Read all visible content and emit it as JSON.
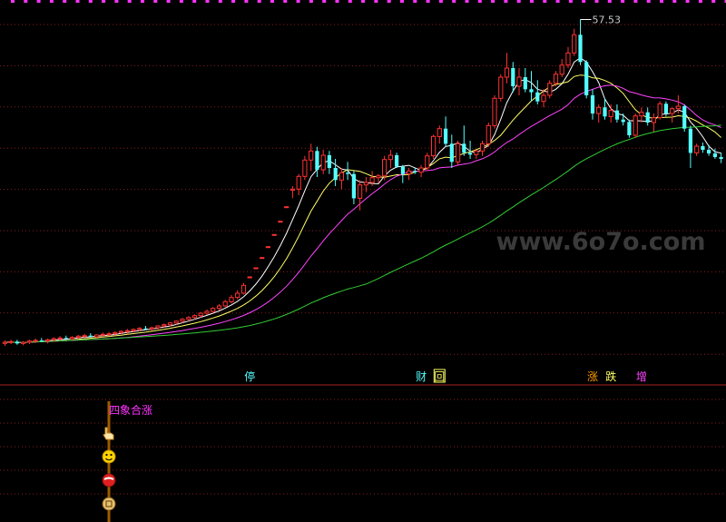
{
  "chart_data": [
    {
      "type": "candlestick",
      "panel": "price",
      "title": "",
      "high_label": "57.53",
      "grid": true,
      "grid_style": "dotted",
      "bg_color": "#000000",
      "up_color": "#ff3232",
      "down_color": "#54ffff",
      "ma_colors": [
        "#ffffff",
        "#ffff66",
        "#ff44ff",
        "#33cc33"
      ],
      "candles_ohlc": [
        [
          4.0,
          4.5,
          3.6,
          4.2
        ],
        [
          4.2,
          4.6,
          3.9,
          4.3
        ],
        [
          4.3,
          4.6,
          3.8,
          4.0
        ],
        [
          4.0,
          4.4,
          3.7,
          4.2
        ],
        [
          4.2,
          4.6,
          3.9,
          4.4
        ],
        [
          4.4,
          4.8,
          4.1,
          4.5
        ],
        [
          4.5,
          4.9,
          4.2,
          4.4
        ],
        [
          4.4,
          4.8,
          4.0,
          4.6
        ],
        [
          4.6,
          5.0,
          4.3,
          4.8
        ],
        [
          4.8,
          5.2,
          4.5,
          4.9
        ],
        [
          4.9,
          5.3,
          4.6,
          4.8
        ],
        [
          4.8,
          5.2,
          4.5,
          5.0
        ],
        [
          5.0,
          5.4,
          4.7,
          5.2
        ],
        [
          5.2,
          5.6,
          4.9,
          5.3
        ],
        [
          5.3,
          5.7,
          5.0,
          5.1
        ],
        [
          5.1,
          5.5,
          4.8,
          5.4
        ],
        [
          5.4,
          5.8,
          5.1,
          5.5
        ],
        [
          5.5,
          5.9,
          5.2,
          5.6
        ],
        [
          5.6,
          6.0,
          5.3,
          5.8
        ],
        [
          5.8,
          6.2,
          5.5,
          6.0
        ],
        [
          6.0,
          6.4,
          5.6,
          6.1
        ],
        [
          6.1,
          6.5,
          5.8,
          6.3
        ],
        [
          6.3,
          6.7,
          6.0,
          6.5
        ],
        [
          6.5,
          6.9,
          6.2,
          6.4
        ],
        [
          6.4,
          6.8,
          6.1,
          6.6
        ],
        [
          6.6,
          7.0,
          6.3,
          6.9
        ],
        [
          6.9,
          7.3,
          6.6,
          7.1
        ],
        [
          7.1,
          7.5,
          6.8,
          7.4
        ],
        [
          7.4,
          7.8,
          7.1,
          7.7
        ],
        [
          7.7,
          8.2,
          7.4,
          8.0
        ],
        [
          8.0,
          8.5,
          7.7,
          8.3
        ],
        [
          8.3,
          8.8,
          8.0,
          8.6
        ],
        [
          8.6,
          9.2,
          8.3,
          9.0
        ],
        [
          9.0,
          9.6,
          8.7,
          9.3
        ],
        [
          9.3,
          10.0,
          9.0,
          9.8
        ],
        [
          9.8,
          10.5,
          9.5,
          10.2
        ],
        [
          10.2,
          11.2,
          10.0,
          10.9
        ],
        [
          10.9,
          12.0,
          10.6,
          11.6
        ],
        [
          11.6,
          12.8,
          11.3,
          12.3
        ],
        [
          12.3,
          14.0,
          12.1,
          13.6
        ],
        [
          15.0,
          15.0,
          15.0,
          15.0
        ],
        [
          16.5,
          16.5,
          16.5,
          16.5
        ],
        [
          18.2,
          18.2,
          18.2,
          18.2
        ],
        [
          20.0,
          20.0,
          20.0,
          20.0
        ],
        [
          22.0,
          22.0,
          22.0,
          22.0
        ],
        [
          24.2,
          24.2,
          24.2,
          24.2
        ],
        [
          26.6,
          26.6,
          26.6,
          26.6
        ],
        [
          29.3,
          30.0,
          28.0,
          29.5
        ],
        [
          29.5,
          32.0,
          28.5,
          31.6
        ],
        [
          31.6,
          35.0,
          31.0,
          34.3
        ],
        [
          34.3,
          37.0,
          32.5,
          35.8
        ],
        [
          35.8,
          36.5,
          31.5,
          32.7
        ],
        [
          32.7,
          36.0,
          32.0,
          35.1
        ],
        [
          35.1,
          35.8,
          32.0,
          33.0
        ],
        [
          33.0,
          34.5,
          30.0,
          31.0
        ],
        [
          31.0,
          33.0,
          29.5,
          32.2
        ],
        [
          32.2,
          34.0,
          31.0,
          32.0
        ],
        [
          32.0,
          32.5,
          27.0,
          28.0
        ],
        [
          28.0,
          31.0,
          26.0,
          30.2
        ],
        [
          30.2,
          31.5,
          29.0,
          30.6
        ],
        [
          30.6,
          32.5,
          30.0,
          31.4
        ],
        [
          31.4,
          32.0,
          30.5,
          31.7
        ],
        [
          31.7,
          35.0,
          31.0,
          34.4
        ],
        [
          34.4,
          36.0,
          33.0,
          35.1
        ],
        [
          35.1,
          35.5,
          33.0,
          33.2
        ],
        [
          33.2,
          33.5,
          30.5,
          32.0
        ],
        [
          32.0,
          33.0,
          31.0,
          32.5
        ],
        [
          32.5,
          33.0,
          32.0,
          32.3
        ],
        [
          32.3,
          33.5,
          31.5,
          33.0
        ],
        [
          33.0,
          35.5,
          32.5,
          35.0
        ],
        [
          35.0,
          38.5,
          34.5,
          38.2
        ],
        [
          38.2,
          40.0,
          37.0,
          39.5
        ],
        [
          39.5,
          41.5,
          36.5,
          37.0
        ],
        [
          37.0,
          38.5,
          33.0,
          34.0
        ],
        [
          34.0,
          37.5,
          33.5,
          37.0
        ],
        [
          37.0,
          40.0,
          35.0,
          35.5
        ],
        [
          35.5,
          37.5,
          34.5,
          35.2
        ],
        [
          35.2,
          36.0,
          34.5,
          35.8
        ],
        [
          35.8,
          37.5,
          35.0,
          37.0
        ],
        [
          37.0,
          40.5,
          36.5,
          40.0
        ],
        [
          40.0,
          45.0,
          39.5,
          44.5
        ],
        [
          44.5,
          48.5,
          44.0,
          48.0
        ],
        [
          48.0,
          52.0,
          47.0,
          49.5
        ],
        [
          49.5,
          50.5,
          45.5,
          46.5
        ],
        [
          46.5,
          49.5,
          45.0,
          48.0
        ],
        [
          48.0,
          49.5,
          45.5,
          46.0
        ],
        [
          46.0,
          49.0,
          44.0,
          45.5
        ],
        [
          45.5,
          47.5,
          43.5,
          44.0
        ],
        [
          44.0,
          46.0,
          43.0,
          45.0
        ],
        [
          45.0,
          47.5,
          44.5,
          47.0
        ],
        [
          47.0,
          49.0,
          46.5,
          48.5
        ],
        [
          48.5,
          51.0,
          48.0,
          50.0
        ],
        [
          50.0,
          53.0,
          49.5,
          52.0
        ],
        [
          52.0,
          56.0,
          51.5,
          55.0
        ],
        [
          55.0,
          57.53,
          50.0,
          50.5
        ],
        [
          50.5,
          50.8,
          44.5,
          45.0
        ],
        [
          45.0,
          46.0,
          41.0,
          42.0
        ],
        [
          42.0,
          43.5,
          40.5,
          43.0
        ],
        [
          43.0,
          44.5,
          41.0,
          41.5
        ],
        [
          41.5,
          43.5,
          40.5,
          42.5
        ],
        [
          42.5,
          43.5,
          40.5,
          41.0
        ],
        [
          41.0,
          42.0,
          40.0,
          40.6
        ],
        [
          40.6,
          41.0,
          38.0,
          38.4
        ],
        [
          38.4,
          42.0,
          38.0,
          41.6
        ],
        [
          41.6,
          43.0,
          40.5,
          42.2
        ],
        [
          42.2,
          43.0,
          40.0,
          40.5
        ],
        [
          40.5,
          42.0,
          39.0,
          41.3
        ],
        [
          41.3,
          44.0,
          41.0,
          43.6
        ],
        [
          43.6,
          44.0,
          41.5,
          42.0
        ],
        [
          42.0,
          43.0,
          40.5,
          42.8
        ],
        [
          42.8,
          45.0,
          42.0,
          43.2
        ],
        [
          43.2,
          43.5,
          39.0,
          39.5
        ],
        [
          39.5,
          40.0,
          33.0,
          35.5
        ],
        [
          35.5,
          37.0,
          35.0,
          36.6
        ],
        [
          36.6,
          37.2,
          35.5,
          36.0
        ],
        [
          36.0,
          36.8,
          35.0,
          35.4
        ],
        [
          35.4,
          36.2,
          34.5,
          34.8
        ],
        [
          34.8,
          35.5,
          33.8,
          34.5
        ]
      ],
      "signals": [
        {
          "text": "停",
          "idx": 40,
          "color": "#54ffff"
        },
        {
          "text": "财",
          "idx": 68,
          "color": "#54ffff"
        },
        {
          "text": "回",
          "idx": 71,
          "color": "#ffff66",
          "boxed": true
        },
        {
          "text": "涨",
          "idx": 96,
          "color": "#ff9900"
        },
        {
          "text": "跌",
          "idx": 99,
          "color": "#ffff66"
        },
        {
          "text": "增",
          "idx": 104,
          "color": "#ff44ff"
        }
      ],
      "y_range": [
        0,
        60
      ]
    },
    {
      "type": "indicator",
      "panel": "sub",
      "label": "四象合涨",
      "label_color": "#ff33ff",
      "icons": [
        "hand-icon",
        "smile-icon",
        "red-ball-icon",
        "coin-icon"
      ]
    }
  ],
  "watermark": "www.6o7o.com",
  "top_marker_color": "#ff33ff"
}
